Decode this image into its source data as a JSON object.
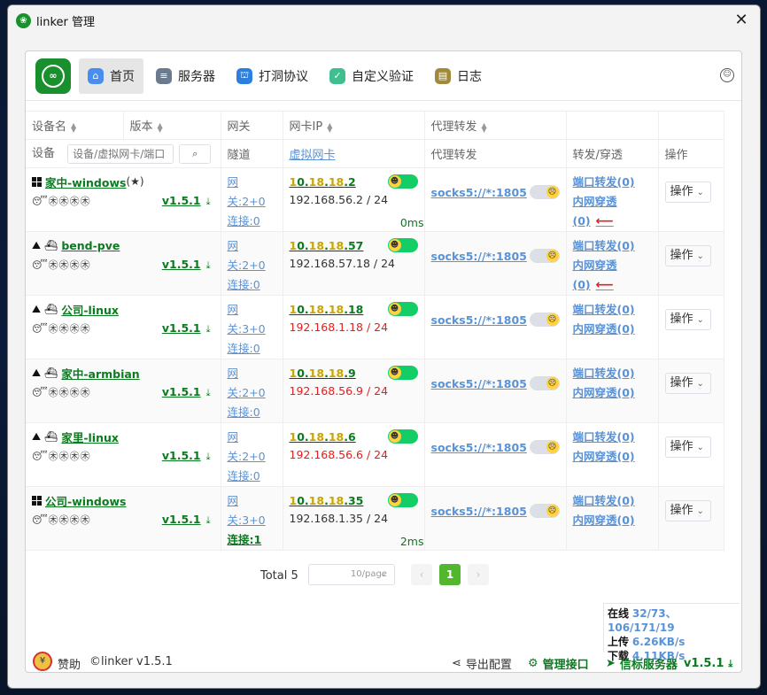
{
  "window": {
    "title": "linker 管理",
    "close": "✕"
  },
  "nav": {
    "items": [
      {
        "label": "首页",
        "active": true,
        "icon": "home-icon",
        "color": "#4a8df0",
        "glyph": "⌂"
      },
      {
        "label": "服务器",
        "active": false,
        "icon": "server-icon",
        "color": "#6a7a8f",
        "glyph": "≡"
      },
      {
        "label": "打洞协议",
        "active": false,
        "icon": "protocol-icon",
        "color": "#2a7fe0",
        "glyph": "⛫"
      },
      {
        "label": "自定义验证",
        "active": false,
        "icon": "shield-icon",
        "color": "#3fbf8f",
        "glyph": "✓"
      },
      {
        "label": "日志",
        "active": false,
        "icon": "log-icon",
        "color": "#a08a3a",
        "glyph": "▤"
      }
    ]
  },
  "table": {
    "headers": {
      "device": "设备名",
      "version": "版本",
      "gateway": "网关",
      "nic_ip": "网卡IP",
      "proxy": "代理转发",
      "forward": "",
      "ops": ""
    },
    "subheaders": {
      "device": "设备",
      "search_placeholder": "设备/虚拟网卡/端口",
      "tunnel": "隧道",
      "virtual_nic": "虚拟网卡",
      "proxy": "代理转发",
      "forward": "转发/穿透",
      "ops": "操作"
    },
    "rows": [
      {
        "os": "windows",
        "docker": false,
        "name": "家中-windows",
        "extra": "(★)",
        "badges": "😴㊍㊍㊍㊍",
        "version": "v1.5.1",
        "gateway": "网关:2+0",
        "connect": "连接:0",
        "connect_ok": false,
        "vip_a": "1",
        "vip_b": "0.",
        "vip_c": "18",
        "vip_d": ".",
        "vip_e": "18",
        "vip_f": ".2",
        "lan": "192.168.56.2 / 24",
        "lan_ok": true,
        "latency": "0ms",
        "proxy": "socks5://*:1805",
        "port_fwd": "端口转发(0)",
        "intranet": "内网穿透(0)",
        "arrow": true,
        "op": "操作"
      },
      {
        "os": "linux",
        "docker": true,
        "name": "bend-pve",
        "extra": "",
        "badges": "😴㊍㊍㊍㊍",
        "version": "v1.5.1",
        "gateway": "网关:2+0",
        "connect": "连接:0",
        "connect_ok": false,
        "vip_a": "1",
        "vip_b": "0.",
        "vip_c": "18",
        "vip_d": ".",
        "vip_e": "18",
        "vip_f": ".57",
        "lan": "192.168.57.18 / 24",
        "lan_ok": true,
        "latency": "",
        "proxy": "socks5://*:1805",
        "port_fwd": "端口转发(0)",
        "intranet": "内网穿透(0)",
        "arrow": true,
        "op": "操作"
      },
      {
        "os": "linux",
        "docker": true,
        "name": "公司-linux",
        "extra": "",
        "badges": "😴㊍㊍㊍㊍",
        "version": "v1.5.1",
        "gateway": "网关:3+0",
        "connect": "连接:0",
        "connect_ok": false,
        "vip_a": "1",
        "vip_b": "0.",
        "vip_c": "18",
        "vip_d": ".",
        "vip_e": "18",
        "vip_f": ".18",
        "lan": "192.168.1.18 / 24",
        "lan_ok": false,
        "latency": "",
        "proxy": "socks5://*:1805",
        "port_fwd": "端口转发(0)",
        "intranet": "内网穿透(0)",
        "arrow": false,
        "op": "操作"
      },
      {
        "os": "linux",
        "docker": true,
        "name": "家中-armbian",
        "extra": "",
        "badges": "😴㊍㊍㊍㊍",
        "version": "v1.5.1",
        "gateway": "网关:2+0",
        "connect": "连接:0",
        "connect_ok": false,
        "vip_a": "1",
        "vip_b": "0.",
        "vip_c": "18",
        "vip_d": ".",
        "vip_e": "18",
        "vip_f": ".9",
        "lan": "192.168.56.9 / 24",
        "lan_ok": false,
        "latency": "",
        "proxy": "socks5://*:1805",
        "port_fwd": "端口转发(0)",
        "intranet": "内网穿透(0)",
        "arrow": false,
        "op": "操作"
      },
      {
        "os": "linux",
        "docker": true,
        "name": "家里-linux",
        "extra": "",
        "badges": "😴㊍㊍㊍㊍",
        "version": "v1.5.1",
        "gateway": "网关:2+0",
        "connect": "连接:0",
        "connect_ok": false,
        "vip_a": "1",
        "vip_b": "0.",
        "vip_c": "18",
        "vip_d": ".",
        "vip_e": "18",
        "vip_f": ".6",
        "lan": "192.168.56.6 / 24",
        "lan_ok": false,
        "latency": "",
        "proxy": "socks5://*:1805",
        "port_fwd": "端口转发(0)",
        "intranet": "内网穿透(0)",
        "arrow": false,
        "op": "操作"
      },
      {
        "os": "windows",
        "docker": false,
        "name": "公司-windows",
        "extra": "",
        "badges": "😴㊍㊍㊍㊍",
        "version": "v1.5.1",
        "gateway": "网关:3+0",
        "connect": "连接:1",
        "connect_ok": true,
        "vip_a": "1",
        "vip_b": "0.",
        "vip_c": "18",
        "vip_d": ".",
        "vip_e": "18",
        "vip_f": ".35",
        "lan": "192.168.1.35 / 24",
        "lan_ok": true,
        "latency": "2ms",
        "proxy": "socks5://*:1805",
        "port_fwd": "端口转发(0)",
        "intranet": "内网穿透(0)",
        "arrow": false,
        "op": "操作"
      }
    ]
  },
  "pager": {
    "total": "Total 5",
    "page_size": "10/page",
    "current": "1",
    "prev": "‹",
    "next": "›"
  },
  "stats": {
    "online_label": "在线",
    "online_value": "32/73、106/171/19",
    "upload_label": "上传",
    "upload_value": "6.26KB/s",
    "download_label": "下载",
    "download_value": "4.11KB/s"
  },
  "bottom": {
    "sponsor": "赞助",
    "copyright": "©linker v1.5.1",
    "export": "导出配置",
    "admin": "管理接口",
    "signal": "信标服务器",
    "signal_version": "v1.5.1"
  }
}
